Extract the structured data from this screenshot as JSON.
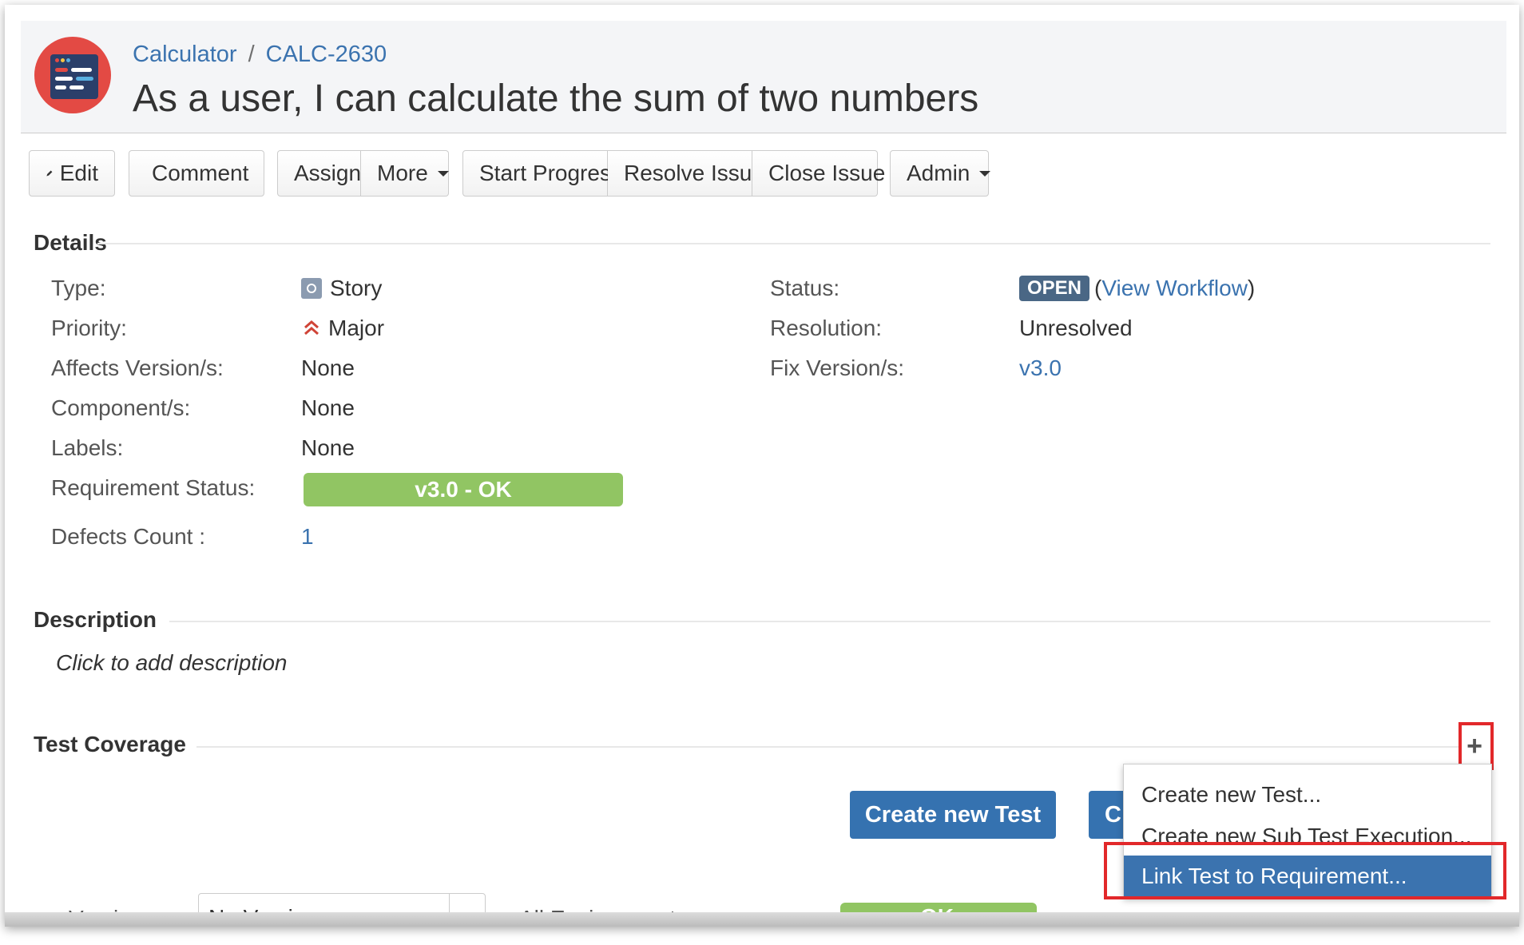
{
  "header": {
    "project": "Calculator",
    "separator": "/",
    "issue_key": "CALC-2630",
    "title": "As a user, I can calculate the sum of two numbers"
  },
  "toolbar": {
    "edit": "Edit",
    "comment": "Comment",
    "assign": "Assign",
    "more": "More",
    "start_progress": "Start Progress",
    "resolve_issue": "Resolve Issue",
    "close_issue": "Close Issue",
    "admin": "Admin"
  },
  "details": {
    "heading": "Details",
    "type_label": "Type:",
    "type_value": "Story",
    "priority_label": "Priority:",
    "priority_value": "Major",
    "affects_label": "Affects Version/s:",
    "affects_value": "None",
    "components_label": "Component/s:",
    "components_value": "None",
    "labels_label": "Labels:",
    "labels_value": "None",
    "req_status_label": "Requirement Status:",
    "req_status_value": "v3.0 - OK",
    "defects_label": "Defects Count :",
    "defects_value": "1",
    "status_label": "Status:",
    "status_value": "OPEN",
    "view_workflow_open": "(",
    "view_workflow": "View Workflow",
    "view_workflow_close": ")",
    "resolution_label": "Resolution:",
    "resolution_value": "Unresolved",
    "fix_label": "Fix Version/s:",
    "fix_value": "v3.0"
  },
  "description": {
    "heading": "Description",
    "placeholder": "Click to add description"
  },
  "test_coverage": {
    "heading": "Test Coverage",
    "plus": "+",
    "create_new_test_button": "Create new Test",
    "second_button_partial": "C",
    "menu": [
      "Create new Test...",
      "Create new Sub Test Execution...",
      "Link Test to Requirement..."
    ],
    "cut_version_label": "Version",
    "cut_version_value": "No Version",
    "cut_env_label": "All Environments",
    "cut_ok": "OK"
  },
  "colors": {
    "link": "#3b73af",
    "ok_green": "#91c563",
    "open_lozenge": "#4a6785",
    "primary_button": "#3572b0",
    "highlight_red": "#e2282a"
  }
}
